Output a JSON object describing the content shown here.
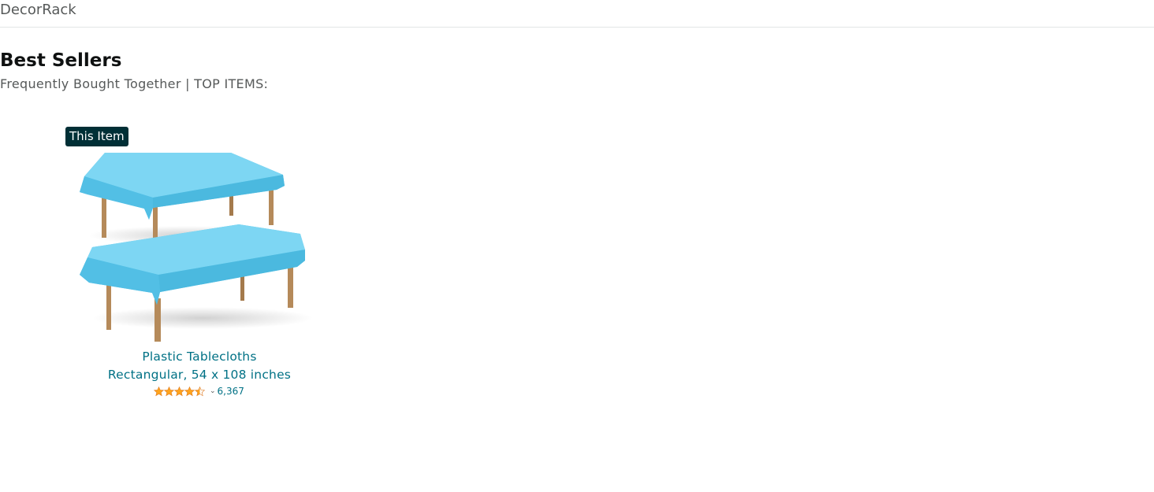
{
  "header": {
    "brand": "DecorRack"
  },
  "section": {
    "title": "Best Sellers",
    "subtitle": "Frequently Bought Together | TOP ITEMS:"
  },
  "product": {
    "badge": "This Item",
    "title_line1": "Plastic Tablecloths",
    "title_line2": "Rectangular, 54 x 108 inches",
    "rating": 4.5,
    "rating_max": 5,
    "review_count": "6,367",
    "image_icon": "blue-tablecloth-tables-image",
    "star_color": "#ffa41c",
    "tablecloth_color": "#5fc8eb"
  },
  "colors": {
    "link": "#007185",
    "badge_bg": "#002f36"
  }
}
